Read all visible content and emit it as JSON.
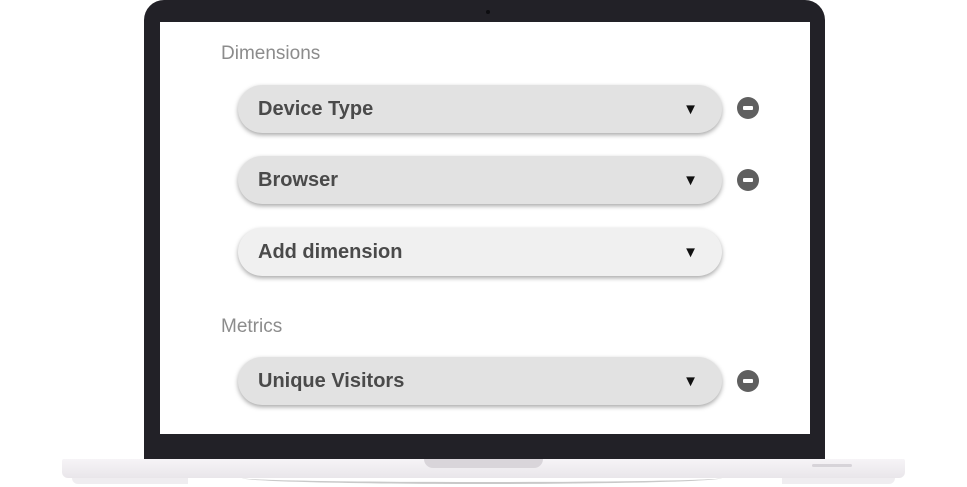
{
  "dimensions": {
    "heading": "Dimensions",
    "items": [
      {
        "label": "Device Type",
        "caret": "▼"
      },
      {
        "label": "Browser",
        "caret": "▼"
      }
    ],
    "add": {
      "label": "Add dimension",
      "caret": "▼"
    }
  },
  "metrics": {
    "heading": "Metrics",
    "items": [
      {
        "label": "Unique Visitors",
        "caret": "▼"
      }
    ]
  },
  "icons": {
    "caret": "caret-down-icon",
    "remove": "minus-circle-icon"
  },
  "colors": {
    "frame": "#222127",
    "select_bg": "#e2e2e2",
    "placeholder_bg": "#f0f0f0",
    "remove_icon": "#5f5f5f",
    "heading_text": "#8c8c8c"
  }
}
